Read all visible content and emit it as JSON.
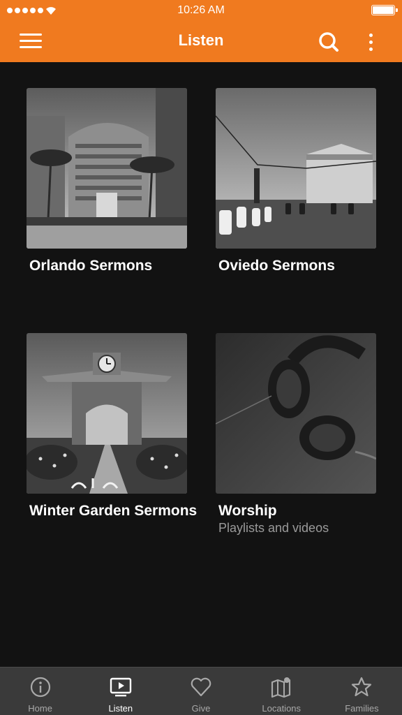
{
  "status_bar": {
    "time": "10:26 AM"
  },
  "header": {
    "title": "Listen"
  },
  "cards": [
    {
      "title": "Orlando Sermons",
      "subtitle": ""
    },
    {
      "title": "Oviedo Sermons",
      "subtitle": ""
    },
    {
      "title": "Winter Garden Sermons",
      "subtitle": ""
    },
    {
      "title": "Worship",
      "subtitle": "Playlists and videos"
    }
  ],
  "tabs": [
    {
      "label": "Home",
      "icon": "info-icon",
      "active": false
    },
    {
      "label": "Listen",
      "icon": "tv-play-icon",
      "active": true
    },
    {
      "label": "Give",
      "icon": "heart-icon",
      "active": false
    },
    {
      "label": "Locations",
      "icon": "map-pin-icon",
      "active": false
    },
    {
      "label": "Families",
      "icon": "star-icon",
      "active": false
    }
  ],
  "colors": {
    "header": "#f07a1f",
    "background": "#121212",
    "tabbar": "#3a3a3a"
  }
}
